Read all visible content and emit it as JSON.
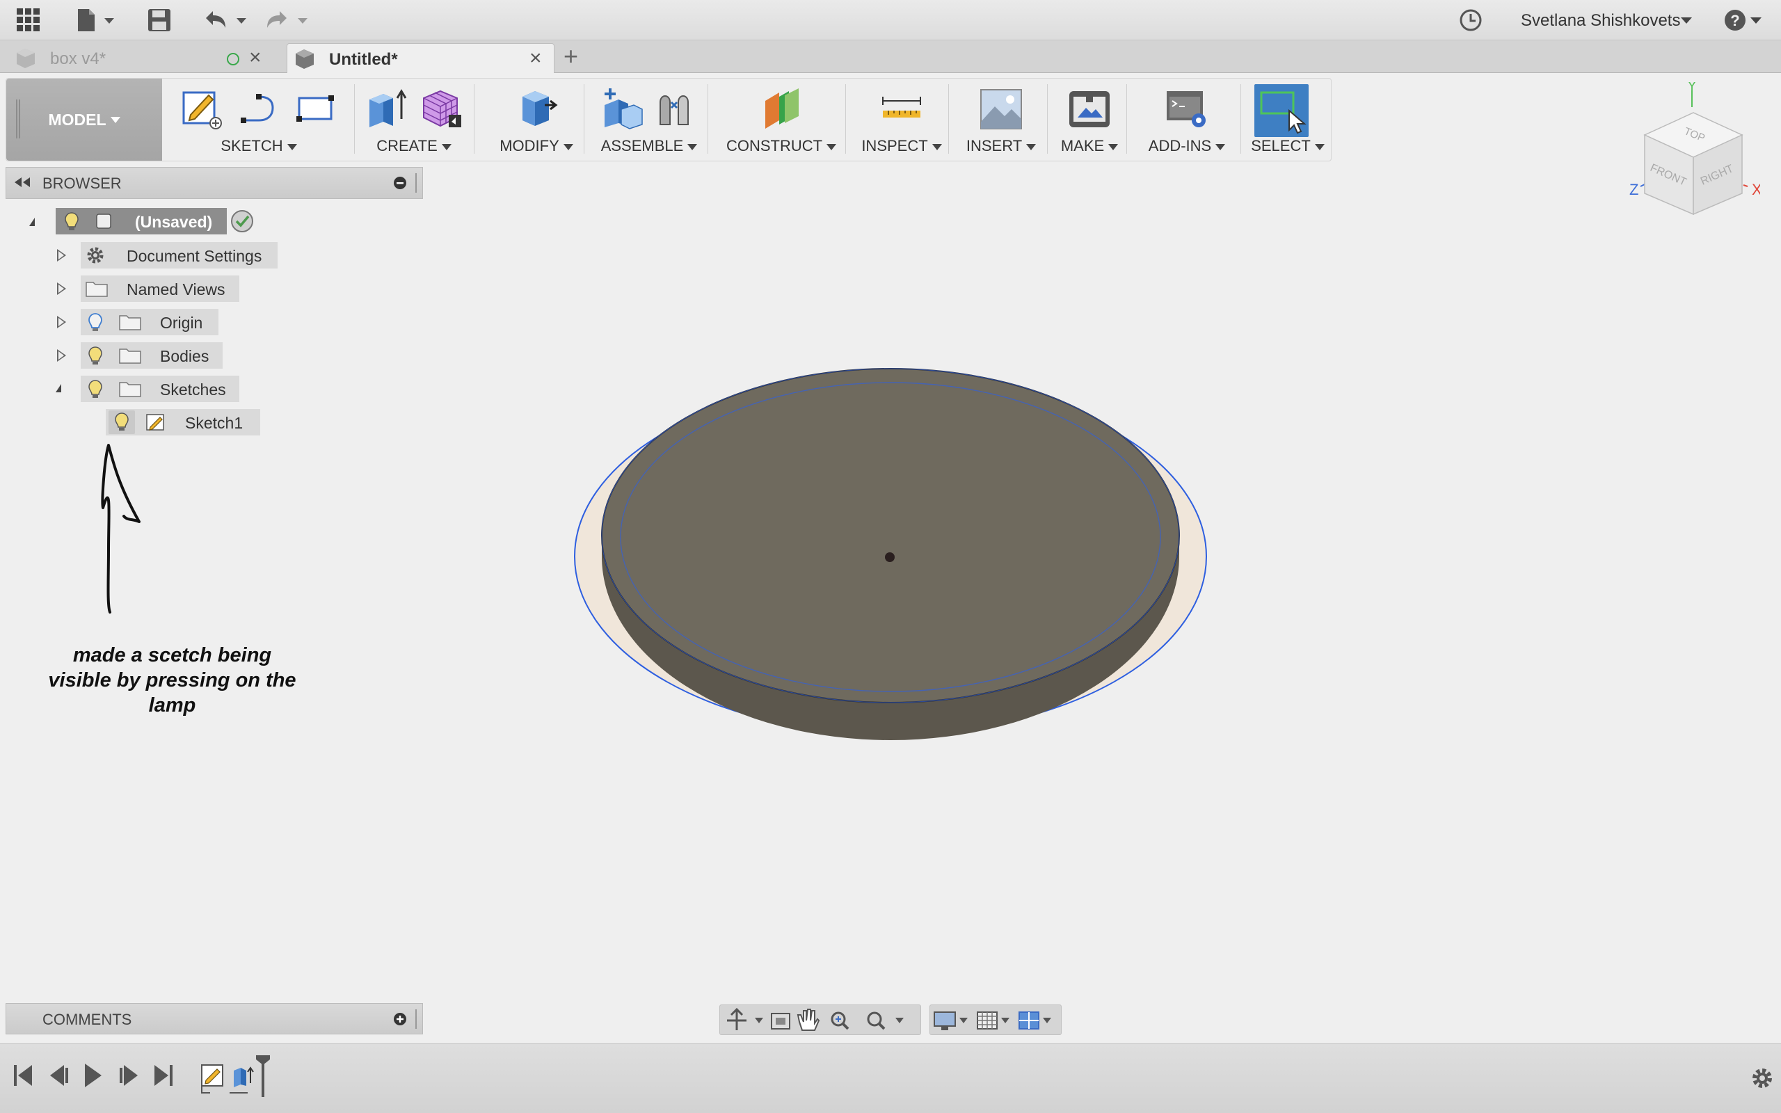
{
  "appbar": {
    "grid_icon": "app-grid-icon",
    "file_icon": "file-icon",
    "save_icon": "save-icon",
    "undo_icon": "undo-icon",
    "redo_icon": "redo-icon",
    "job_status_icon": "clock-icon",
    "user_name": "Svetlana Shishkovets",
    "help_icon": "help-icon"
  },
  "tabs": [
    {
      "label": "box v4*",
      "active": false
    },
    {
      "label": "Untitled*",
      "active": true
    }
  ],
  "toolbar": {
    "workspace": "MODEL",
    "groups": [
      {
        "label": "SKETCH"
      },
      {
        "label": "CREATE"
      },
      {
        "label": "MODIFY"
      },
      {
        "label": "ASSEMBLE"
      },
      {
        "label": "CONSTRUCT"
      },
      {
        "label": "INSPECT"
      },
      {
        "label": "INSERT"
      },
      {
        "label": "MAKE"
      },
      {
        "label": "ADD-INS"
      },
      {
        "label": "SELECT"
      }
    ]
  },
  "browser": {
    "title": "BROWSER",
    "root": "(Unsaved)",
    "items": [
      {
        "label": "Document Settings"
      },
      {
        "label": "Named Views"
      },
      {
        "label": "Origin"
      },
      {
        "label": "Bodies"
      },
      {
        "label": "Sketches"
      },
      {
        "label": "Sketch1"
      }
    ]
  },
  "annotation": {
    "line1": "made a scetch being",
    "line2": "visible by pressing on the",
    "line3": "lamp"
  },
  "comments": {
    "title": "COMMENTS"
  },
  "viewcube": {
    "faces": {
      "top": "TOP",
      "front": "FRONT",
      "right": "RIGHT"
    },
    "axes": {
      "x": "X",
      "y": "Y",
      "z": "Z"
    },
    "axis_colors": {
      "x": "#e0483b",
      "y": "#58c15a",
      "z": "#3f6fd8"
    }
  },
  "colors": {
    "accent": "#3e7fc3",
    "body_fill": "#6f6a5e",
    "sketch_line": "#2e5fe0",
    "profile_fill": "#f0e6da"
  }
}
